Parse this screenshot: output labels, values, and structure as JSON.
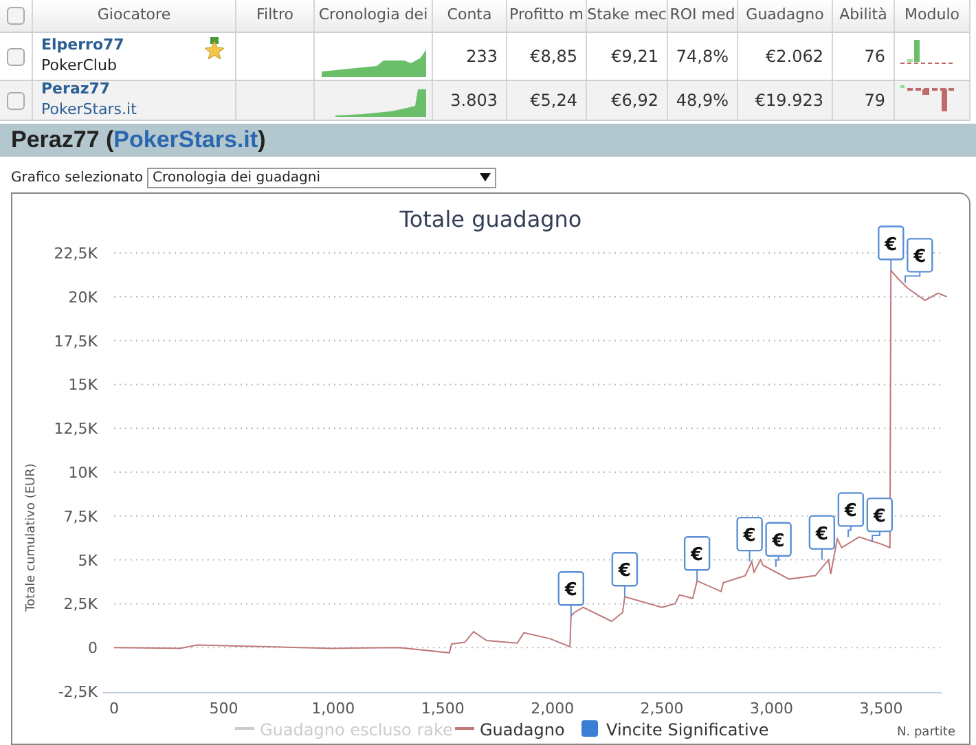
{
  "table": {
    "select_all": {
      "checked": false
    },
    "columns": [
      {
        "label": "Giocatore"
      },
      {
        "label": "Filtro"
      },
      {
        "label": "Cronologia dei"
      },
      {
        "label": "Conta"
      },
      {
        "label": "Profitto m"
      },
      {
        "label": "Stake mec"
      },
      {
        "label": "ROI med"
      },
      {
        "label": "Guadagno"
      },
      {
        "label": "Abilità"
      },
      {
        "label": "Modulo"
      }
    ],
    "rows": [
      {
        "checked": false,
        "selected": false,
        "player": "Elperro77",
        "site": "PokerClub",
        "site_link": false,
        "award": true,
        "count": "233",
        "profit": "€8,85",
        "stake": "€9,21",
        "roi": "74,8%",
        "earnings": "€2.062",
        "skill": "76"
      },
      {
        "checked": false,
        "selected": true,
        "player": "Peraz77",
        "site": "PokerStars.it",
        "site_link": true,
        "award": false,
        "count": "3.803",
        "profit": "€5,24",
        "stake": "€6,92",
        "roi": "48,9%",
        "earnings": "€19.923",
        "skill": "79"
      }
    ]
  },
  "detail": {
    "title_prefix": "Peraz77 (",
    "site": "PokerStars.it",
    "title_suffix": ")"
  },
  "selector": {
    "label": "Grafico selezionato",
    "value": "Cronologia dei guadagni"
  },
  "chart_data": {
    "type": "line",
    "title": "Totale guadagno",
    "xlabel": "N. partite",
    "ylabel": "Totale cumulativo (EUR)",
    "x": [
      0,
      300,
      380,
      700,
      1000,
      1300,
      1530,
      1540,
      1600,
      1640,
      1700,
      1840,
      1870,
      1990,
      2080,
      2085,
      2100,
      2140,
      2270,
      2320,
      2330,
      2500,
      2560,
      2580,
      2640,
      2660,
      2770,
      2780,
      2880,
      2910,
      2920,
      2950,
      2960,
      3080,
      3200,
      3260,
      3270,
      3300,
      3320,
      3400,
      3500,
      3540,
      3545,
      3580,
      3620,
      3700,
      3760,
      3800
    ],
    "series": [
      {
        "name": "Guadagno",
        "color": "#c0787a",
        "values": [
          0,
          -50,
          150,
          50,
          -50,
          0,
          -300,
          200,
          300,
          900,
          400,
          250,
          850,
          500,
          50,
          1800,
          2000,
          2300,
          1500,
          2000,
          2900,
          2300,
          2500,
          3000,
          2800,
          3800,
          3200,
          3700,
          4100,
          4900,
          4300,
          5000,
          4700,
          3900,
          4100,
          5000,
          4200,
          6200,
          5700,
          6300,
          5900,
          5700,
          21500,
          21000,
          20500,
          19800,
          20200,
          20000
        ]
      }
    ],
    "grid": true,
    "xlim": [
      0,
      3800
    ],
    "ylim": [
      -2500,
      22500
    ],
    "xticks": [
      {
        "value": 0,
        "label": "0"
      },
      {
        "value": 500,
        "label": "500"
      },
      {
        "value": 1000,
        "label": "1,000"
      },
      {
        "value": 1500,
        "label": "1,500"
      },
      {
        "value": 2000,
        "label": "2,000"
      },
      {
        "value": 2500,
        "label": "2,500"
      },
      {
        "value": 3000,
        "label": "3,000"
      },
      {
        "value": 3500,
        "label": "3,500"
      }
    ],
    "yticks": [
      {
        "value": -2500,
        "label": "-2,5K"
      },
      {
        "value": 0,
        "label": "0"
      },
      {
        "value": 2500,
        "label": "2,5K"
      },
      {
        "value": 5000,
        "label": "5K"
      },
      {
        "value": 7500,
        "label": "7,5K"
      },
      {
        "value": 10000,
        "label": "10K"
      },
      {
        "value": 12500,
        "label": "12,5K"
      },
      {
        "value": 15000,
        "label": "15K"
      },
      {
        "value": 17500,
        "label": "17,5K"
      },
      {
        "value": 20000,
        "label": "20K"
      },
      {
        "value": 22500,
        "label": "22,5K"
      }
    ],
    "annotations": [
      {
        "x": 2085,
        "y": 1800,
        "text": "€"
      },
      {
        "x": 2330,
        "y": 2900,
        "text": "€"
      },
      {
        "x": 2660,
        "y": 3800,
        "text": "€"
      },
      {
        "x": 2900,
        "y": 4900,
        "text": "€"
      },
      {
        "x": 3020,
        "y": 4600,
        "text": "€"
      },
      {
        "x": 3230,
        "y": 5000,
        "text": "€"
      },
      {
        "x": 3350,
        "y": 6300,
        "text": "€"
      },
      {
        "x": 3460,
        "y": 6000,
        "text": "€"
      },
      {
        "x": 3545,
        "y": 21500,
        "text": "€"
      },
      {
        "x": 3610,
        "y": 20800,
        "text": "€"
      }
    ]
  },
  "legend": [
    {
      "label": "Guadagno escluso rake",
      "kind": "line",
      "visible": false
    },
    {
      "kind": "series",
      "visible": true
    },
    {
      "label": "Vincite Significative",
      "kind": "box",
      "visible": true,
      "color": "#3a7fd5"
    }
  ]
}
